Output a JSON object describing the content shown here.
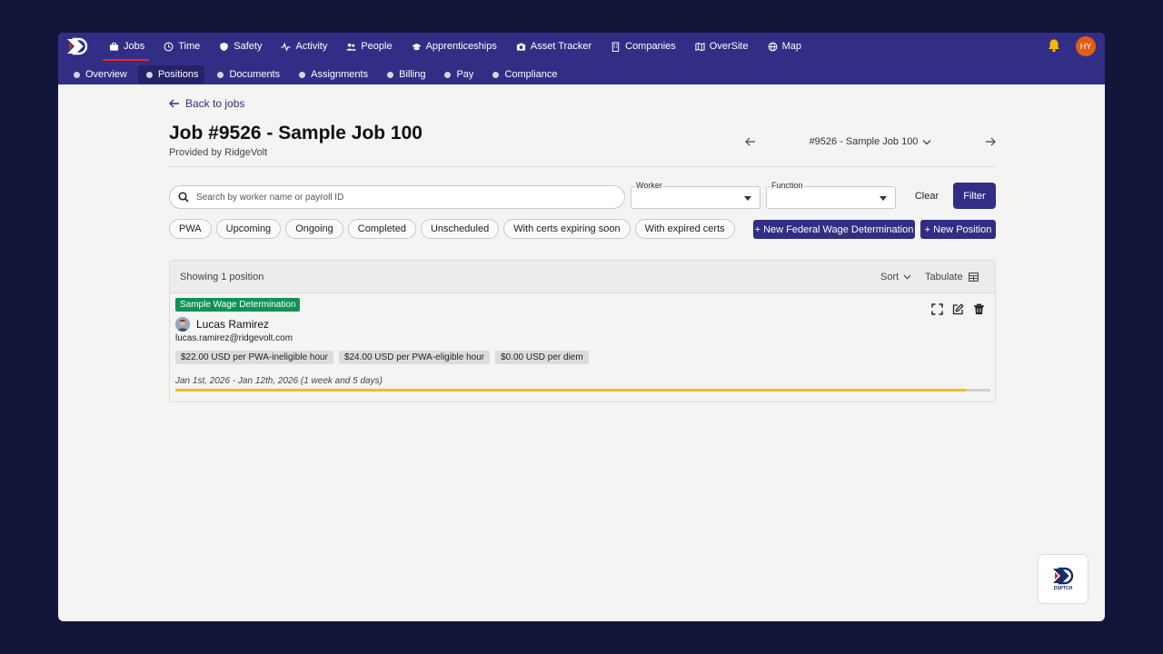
{
  "nav": {
    "items": [
      {
        "label": "Jobs",
        "icon": "briefcase-icon",
        "active": true
      },
      {
        "label": "Time",
        "icon": "clock-icon"
      },
      {
        "label": "Safety",
        "icon": "shield-icon"
      },
      {
        "label": "Activity",
        "icon": "pulse-icon"
      },
      {
        "label": "People",
        "icon": "people-icon"
      },
      {
        "label": "Apprenticeships",
        "icon": "graduation-cap-icon"
      },
      {
        "label": "Asset Tracker",
        "icon": "camera-icon"
      },
      {
        "label": "Companies",
        "icon": "building-icon"
      },
      {
        "label": "OverSite",
        "icon": "map-fold-icon"
      },
      {
        "label": "Map",
        "icon": "globe-icon"
      }
    ],
    "user_initials": "HY"
  },
  "subnav": {
    "items": [
      {
        "label": "Overview"
      },
      {
        "label": "Positions",
        "active": true
      },
      {
        "label": "Documents"
      },
      {
        "label": "Assignments"
      },
      {
        "label": "Billing"
      },
      {
        "label": "Pay"
      },
      {
        "label": "Compliance"
      }
    ]
  },
  "page": {
    "back_label": "Back to jobs",
    "title": "Job #9526 - Sample Job 100",
    "provided_by": "Provided by RidgeVolt",
    "job_selector": "#9526 - Sample Job 100"
  },
  "filters": {
    "search_placeholder": "Search by worker name or payroll ID",
    "worker_label": "Worker",
    "function_label": "Function",
    "clear_label": "Clear",
    "filter_label": "Filter",
    "chips": [
      "PWA",
      "Upcoming",
      "Ongoing",
      "Completed",
      "Unscheduled",
      "With certs expiring soon",
      "With expired certs"
    ],
    "new_fwd_label": "+ New Federal Wage Determination",
    "new_position_label": "+ New Position"
  },
  "list": {
    "count_text": "Showing 1 position",
    "sort_label": "Sort",
    "tabulate_label": "Tabulate",
    "position": {
      "wage_determination": "Sample Wage Determination",
      "worker_name": "Lucas Ramirez",
      "worker_email": "lucas.ramirez@ridgevolt.com",
      "rates": [
        "$22.00 USD per PWA-ineligible hour",
        "$24.00 USD per PWA-eligible hour",
        "$0.00 USD per diem"
      ],
      "dates": "Jan 1st, 2026 - Jan 12th, 2026 (1 week and 5 days)",
      "progress_fraction": 0.97
    }
  },
  "help": {
    "label": "DSPTCH"
  },
  "colors": {
    "brand": "#322e86",
    "badge_green": "#119157",
    "progress": "#f0ba2c",
    "avatar": "#e35d12"
  }
}
